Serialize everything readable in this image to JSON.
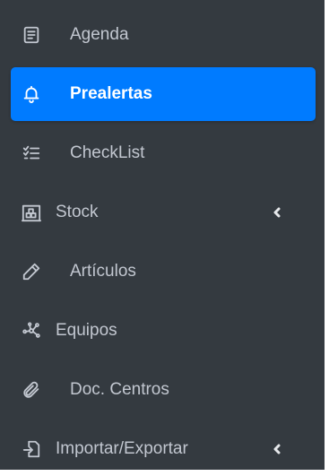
{
  "sidebar": {
    "items": [
      {
        "label": "Agenda",
        "icon": "book-icon",
        "active": false
      },
      {
        "label": "Prealertas",
        "icon": "bell-icon",
        "active": true
      },
      {
        "label": "CheckList",
        "icon": "checklist-icon",
        "active": false
      },
      {
        "label": "Stock",
        "icon": "warehouse-icon",
        "active": false,
        "expandable": true
      },
      {
        "label": "Artículos",
        "icon": "pencil-icon",
        "active": false
      },
      {
        "label": "Equipos",
        "icon": "network-icon",
        "active": false
      },
      {
        "label": "Doc. Centros",
        "icon": "paperclip-icon",
        "active": false
      },
      {
        "label": "Importar/Exportar",
        "icon": "import-export-icon",
        "active": false,
        "expandable": true
      }
    ]
  },
  "colors": {
    "sidebar_bg": "#343a40",
    "active_bg": "#007bff",
    "text": "#c2c7d0",
    "active_text": "#ffffff"
  }
}
